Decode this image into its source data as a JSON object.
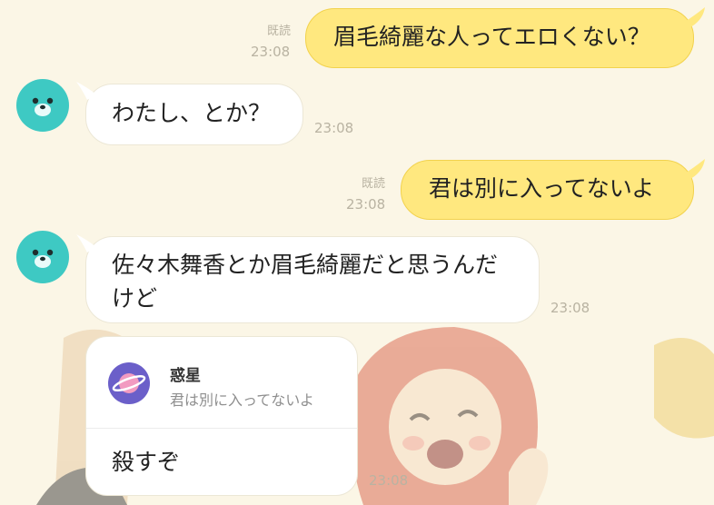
{
  "messages": [
    {
      "side": "mine",
      "text": "眉毛綺麗な人ってエロくない？",
      "read": "既読",
      "time": "23:08"
    },
    {
      "side": "theirs",
      "text": "わたし、とか？",
      "time": "23:08"
    },
    {
      "side": "mine",
      "text": "君は別に入ってないよ",
      "read": "既読",
      "time": "23:08"
    },
    {
      "side": "theirs",
      "line1": "佐々木舞香とか眉毛綺麗だと思うんだ",
      "line2": "けど",
      "time": "23:08"
    }
  ],
  "reply": {
    "quoted_name": "惑星",
    "quoted_text": "君は別に入ってないよ",
    "text": "殺すぞ",
    "time": "23:08"
  },
  "colors": {
    "mine_bubble": "#ffe87f",
    "theirs_bubble": "#ffffff",
    "avatar": "#3ec9c3",
    "background": "#fbf6e6"
  }
}
